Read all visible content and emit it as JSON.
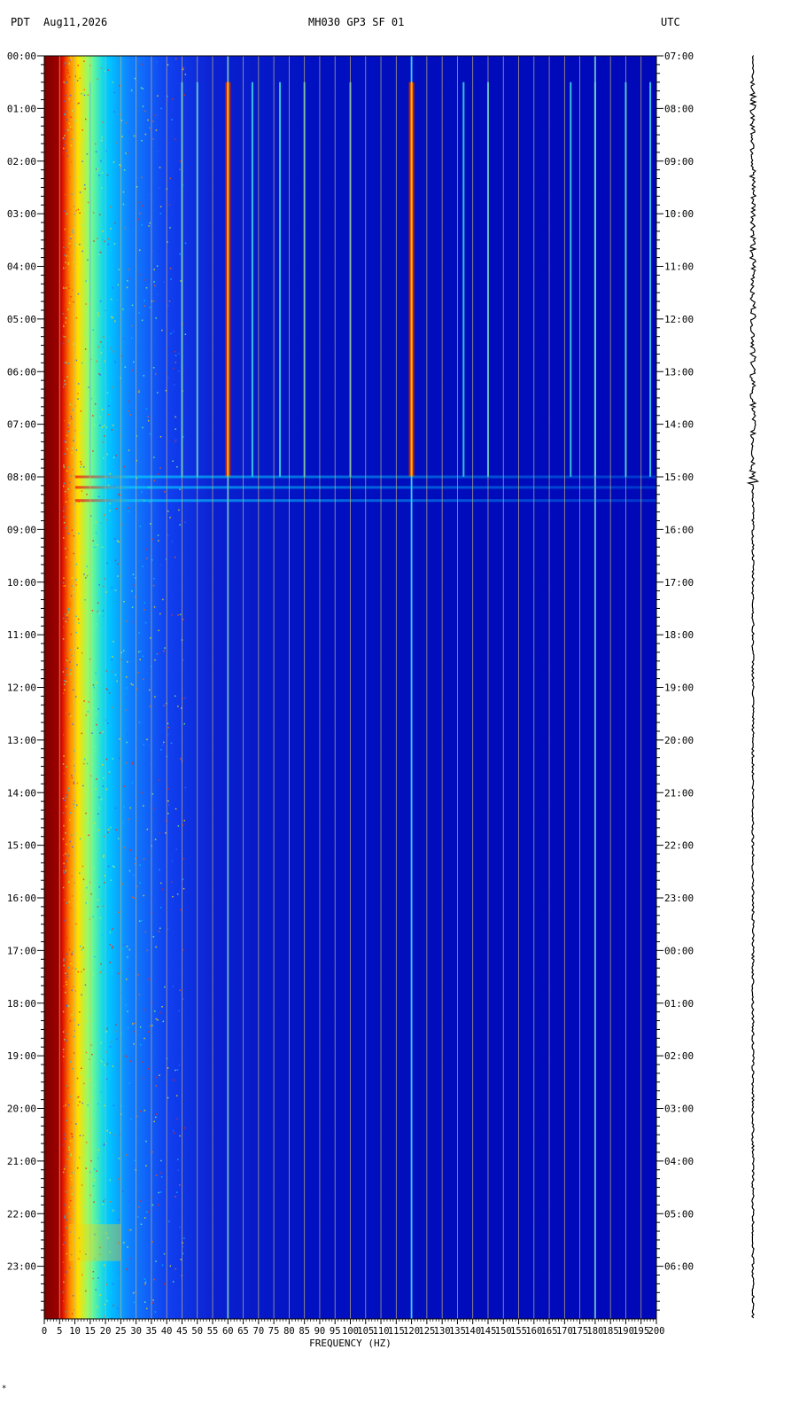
{
  "header": {
    "left_tz": "PDT",
    "date": "Aug11,2026",
    "station": "MH030 GP3 SF 01",
    "right_tz": "UTC"
  },
  "footnote": "*",
  "chart_data": {
    "type": "heatmap",
    "title": "MH030 GP3 SF 01",
    "xlabel": "FREQUENCY (HZ)",
    "xlim": [
      0,
      200
    ],
    "x_ticks": [
      "0",
      "5",
      "10",
      "15",
      "20",
      "25",
      "30",
      "35",
      "40",
      "45",
      "50",
      "55",
      "60",
      "65",
      "70",
      "75",
      "80",
      "85",
      "90",
      "95",
      "100",
      "105",
      "110",
      "115",
      "120",
      "125",
      "130",
      "135",
      "140",
      "145",
      "150",
      "155",
      "160",
      "165",
      "170",
      "175",
      "180",
      "185",
      "190",
      "195",
      "200"
    ],
    "left_axis_title": "PDT",
    "left_ticks": [
      "00:00",
      "01:00",
      "02:00",
      "03:00",
      "04:00",
      "05:00",
      "06:00",
      "07:00",
      "08:00",
      "09:00",
      "10:00",
      "11:00",
      "12:00",
      "13:00",
      "14:00",
      "15:00",
      "16:00",
      "17:00",
      "18:00",
      "19:00",
      "20:00",
      "21:00",
      "22:00",
      "23:00"
    ],
    "right_axis_title": "UTC",
    "right_ticks": [
      "07:00",
      "08:00",
      "09:00",
      "10:00",
      "11:00",
      "12:00",
      "13:00",
      "14:00",
      "15:00",
      "16:00",
      "17:00",
      "18:00",
      "19:00",
      "20:00",
      "21:00",
      "22:00",
      "23:00",
      "00:00",
      "01:00",
      "02:00",
      "03:00",
      "04:00",
      "05:00",
      "06:00"
    ],
    "grid": true,
    "colormap": "jet",
    "low_frequency_energy": [
      {
        "from_hz": 0,
        "to_hz": 5,
        "level": "max"
      },
      {
        "from_hz": 5,
        "to_hz": 10,
        "level": "very high"
      },
      {
        "from_hz": 10,
        "to_hz": 20,
        "level": "high"
      },
      {
        "from_hz": 20,
        "to_hz": 50,
        "level": "moderate"
      },
      {
        "from_hz": 50,
        "to_hz": 200,
        "level": "low"
      }
    ],
    "persistent_lines_hz": [
      60,
      120,
      180
    ],
    "harmonic_lines_hz": [
      15,
      45,
      50,
      60,
      68,
      77,
      85,
      100,
      120,
      137,
      145,
      172,
      180,
      190,
      198
    ],
    "harmonic_lines_period": {
      "start_hour": 0.5,
      "end_hour": 8.0
    },
    "broadband_event_hours": [
      8.0,
      8.2,
      8.45
    ],
    "late_disturbance_hours": {
      "start": 22.2,
      "end": 22.9,
      "max_hz": 25
    }
  }
}
